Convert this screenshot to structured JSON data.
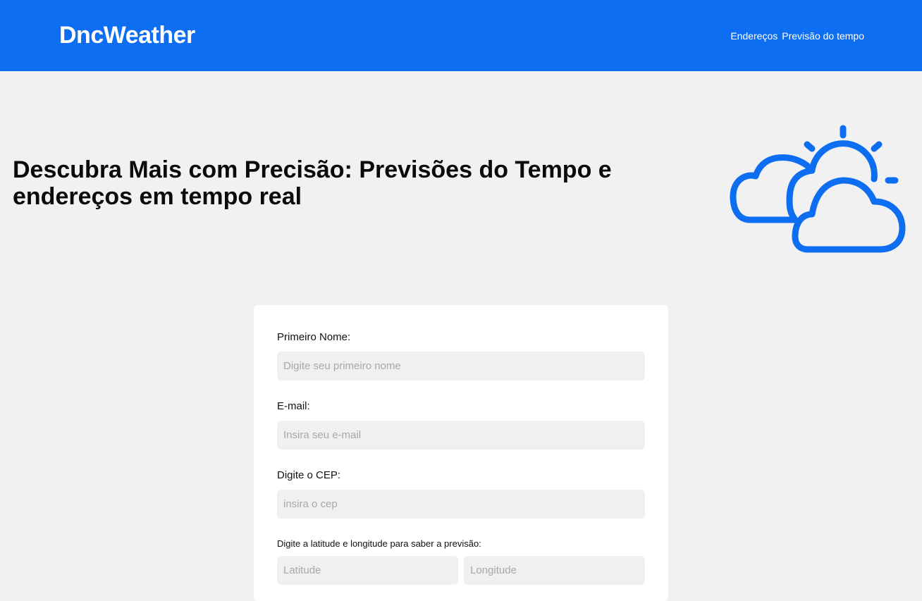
{
  "header": {
    "brand": "DncWeather",
    "nav": [
      {
        "label": "Endereços"
      },
      {
        "label": "Previsão do tempo"
      }
    ]
  },
  "hero": {
    "title": "Descubra Mais com Precisão: Previsões do Tempo e endereços em tempo real",
    "icon": "partly-cloudy-sun-icon"
  },
  "form": {
    "first_name": {
      "label": "Primeiro Nome:",
      "placeholder": "Digite seu primeiro nome",
      "value": ""
    },
    "email": {
      "label": "E-mail:",
      "placeholder": "Insira seu e-mail",
      "value": ""
    },
    "cep": {
      "label": "Digite o CEP:",
      "placeholder": "insira o cep",
      "value": ""
    },
    "coords": {
      "label": "Digite a latitude e longitude para saber a previsão:",
      "latitude_placeholder": "Latitude",
      "longitude_placeholder": "Longitude"
    }
  },
  "colors": {
    "accent": "#0d6ef2",
    "background": "#f1f1f1",
    "card": "#ffffff",
    "input_bg": "#f0f0f0"
  }
}
